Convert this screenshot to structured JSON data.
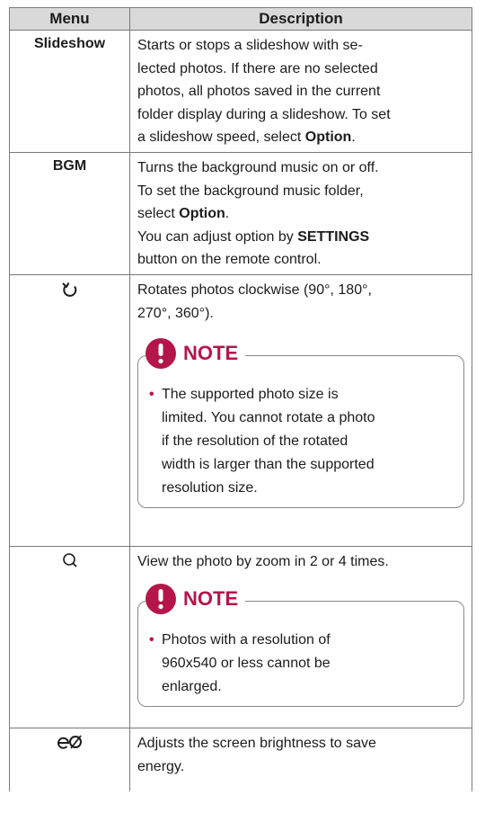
{
  "table": {
    "headers": {
      "menu": "Menu",
      "description": "Description"
    },
    "rows": {
      "slideshow": {
        "menu": "Slideshow",
        "lines": [
          "Starts or stops a slideshow with se-",
          "lected photos. If there are no selected",
          "photos, all photos saved in the current",
          "folder display during a slideshow. To set"
        ],
        "last_prefix": "a slideshow speed, select ",
        "last_bold": "Option",
        "last_suffix": "."
      },
      "bgm": {
        "menu": "BGM",
        "line1": "Turns the background music on or off.",
        "line2": "To set the background music folder,",
        "line3_prefix": "select ",
        "line3_bold": "Option",
        "line3_suffix": ".",
        "line4_prefix": "You can adjust option by ",
        "line4_bold": "SETTINGS",
        "line5": "button on the remote control."
      },
      "rotate": {
        "icon": "rotate-clockwise-icon",
        "line1": "Rotates photos clockwise (90°, 180°,",
        "line2": "270°, 360°).",
        "note_title": "NOTE",
        "note_lines": [
          "The supported photo size is",
          "limited. You cannot rotate a photo",
          "if the resolution of the rotated",
          "width is larger than the supported",
          "resolution size."
        ]
      },
      "zoom": {
        "icon": "zoom-icon",
        "line1": "View the photo by zoom in 2 or 4 times.",
        "note_title": "NOTE",
        "note_lines": [
          "Photos with a resolution of",
          "960x540 or less cannot be",
          "enlarged."
        ]
      },
      "energy": {
        "icon": "energy-saving-icon",
        "line1": "Adjusts the screen brightness to save",
        "line2": "energy."
      }
    },
    "colors": {
      "accent": "#b5164a",
      "header_bg": "#d9d9d9",
      "border": "#7a7a7a"
    }
  }
}
